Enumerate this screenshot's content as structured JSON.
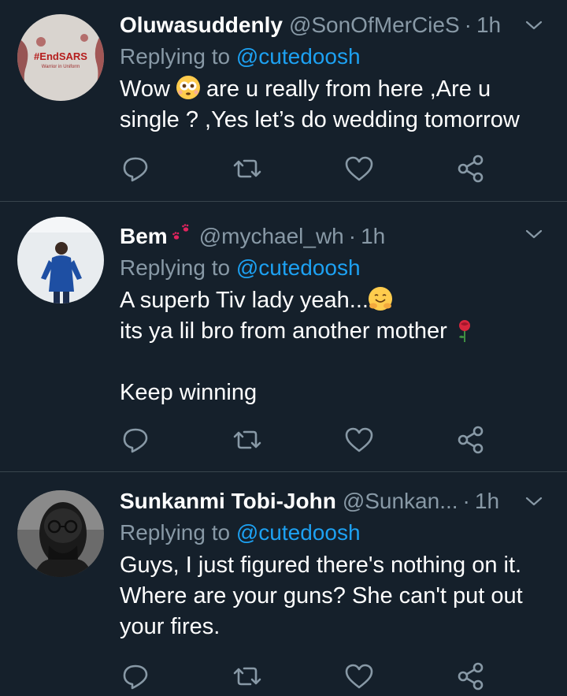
{
  "colors": {
    "background": "#15202b",
    "divider": "#38444d",
    "secondary_text": "#8899a6",
    "mention": "#1da1f2"
  },
  "tweets": [
    {
      "name": "Oluwasuddenly",
      "handle": "@SonOfMerCieS",
      "dot": "·",
      "time": "1h",
      "replying_prefix": "Replying to",
      "replying_to": "@cutedoosh",
      "avatar_text": "#EndSARS",
      "avatar_subtext": "Warrior in Uniform",
      "lines": [
        {
          "before": "Wow ",
          "emoji": "flushed-face",
          "after": " are u really from here ,Are u"
        },
        {
          "text": "single ? ,Yes let’s do wedding tomorrow"
        }
      ]
    },
    {
      "name": "Bem",
      "name_emoji": "paw-prints",
      "handle": "@mychael_wh",
      "dot": "·",
      "time": "1h",
      "replying_prefix": "Replying to",
      "replying_to": "@cutedoosh",
      "lines": [
        {
          "text": "A superb Tiv lady yeah...",
          "emoji": "hugging-face"
        },
        {
          "text": "its ya lil bro from another mother ",
          "emoji": "rose"
        },
        {
          "text": ""
        },
        {
          "text": "Keep winning"
        }
      ]
    },
    {
      "name": "Sunkanmi Tobi-John",
      "handle": "@Sunkan...",
      "dot": "·",
      "time": "1h",
      "replying_prefix": "Replying to",
      "replying_to": "@cutedoosh",
      "lines": [
        {
          "text": "Guys, I just figured there's nothing on it."
        },
        {
          "text": "Where are your guns? She can't put out"
        },
        {
          "text": "your fires."
        }
      ]
    }
  ],
  "action_icons": [
    "reply-icon",
    "retweet-icon",
    "like-icon",
    "share-icon"
  ]
}
